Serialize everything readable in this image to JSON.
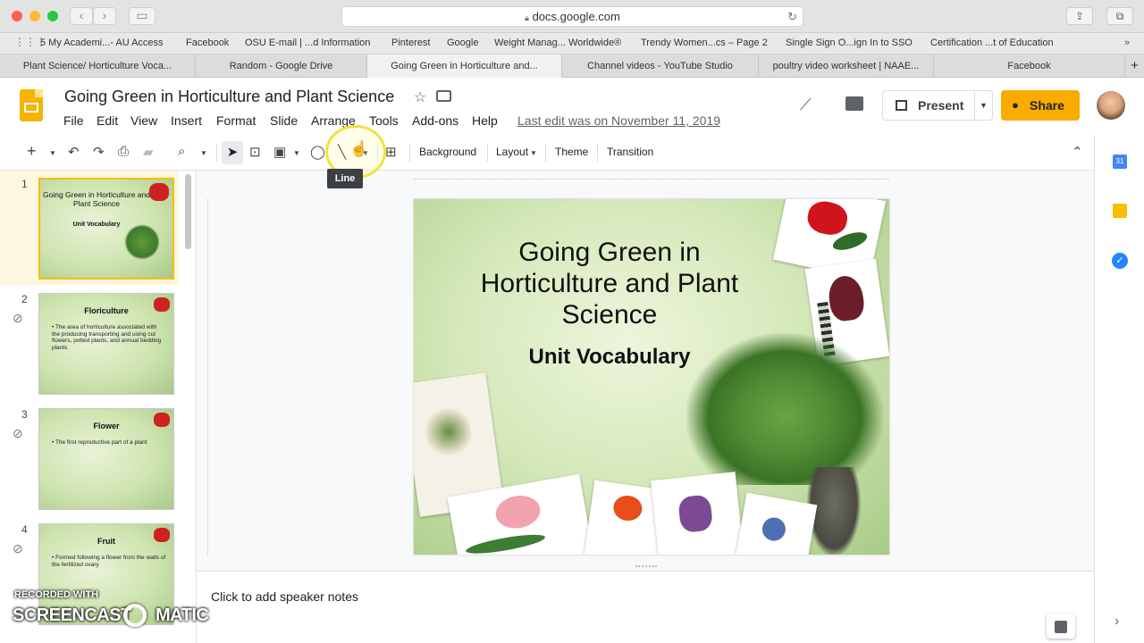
{
  "browser": {
    "url": "docs.google.com",
    "bookmarks": [
      "5 My Academi...- AU Access",
      "Facebook",
      "OSU E-mail | ...d Information",
      "Pinterest",
      "Google",
      "Weight Manag... Worldwide®",
      "Trendy Women...cs – Page 2",
      "Single Sign O...ign In to SSO",
      "Certification ...t of Education"
    ],
    "tabs": [
      "Plant Science/ Horticulture Voca...",
      "Random - Google Drive",
      "Going Green in Horticulture and...",
      "Channel videos - YouTube Studio",
      "poultry video worksheet | NAAE...",
      "Facebook"
    ]
  },
  "app": {
    "title": "Going Green in Horticulture and Plant Science",
    "menu": [
      "File",
      "Edit",
      "View",
      "Insert",
      "Format",
      "Slide",
      "Arrange",
      "Tools",
      "Add-ons",
      "Help"
    ],
    "last_edit": "Last edit was on November 11, 2019",
    "present_label": "Present",
    "share_label": "Share"
  },
  "toolbar": {
    "background_label": "Background",
    "layout_label": "Layout",
    "theme_label": "Theme",
    "transition_label": "Transition",
    "tooltip": "Line"
  },
  "slides": [
    {
      "num": "1",
      "title": "Going Green in Horticulture and Plant Science",
      "subtitle": "Unit Vocabulary",
      "body": ""
    },
    {
      "num": "2",
      "title": "Floriculture",
      "subtitle": "",
      "body": "• The area of horticulture associated with the producing transporting and using cut flowers, potted plants, and annual bedding plants"
    },
    {
      "num": "3",
      "title": "Flower",
      "subtitle": "",
      "body": "• The first reproductive part of a plant"
    },
    {
      "num": "4",
      "title": "Fruit",
      "subtitle": "",
      "body": "• Formed following a flower from the walls of the fertilized ovary"
    }
  ],
  "main_slide": {
    "title": "Going Green in Horticulture and Plant Science",
    "subtitle": "Unit Vocabulary"
  },
  "notes_placeholder": "Click to add speaker notes",
  "watermark": {
    "top": "RECORDED WITH",
    "brand_left": "SCREENCAST",
    "brand_right": "MATIC"
  },
  "colors": {
    "accent": "#f9ab00",
    "slides_yellow": "#f4b400",
    "selected_thumb": "#fbbc04"
  }
}
